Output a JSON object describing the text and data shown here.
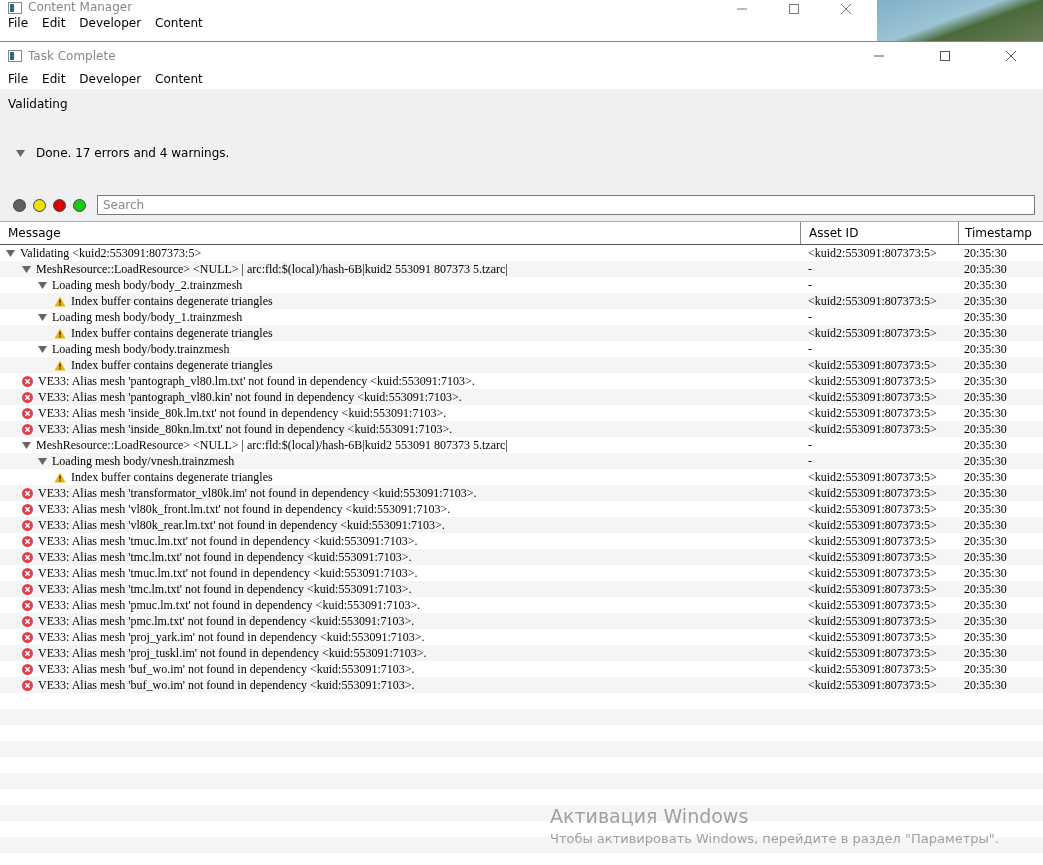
{
  "background_window": {
    "title": "Content Manager",
    "menu": [
      "File",
      "Edit",
      "Developer",
      "Content"
    ]
  },
  "window": {
    "title": "Task Complete",
    "menu": [
      "File",
      "Edit",
      "Developer",
      "Content"
    ]
  },
  "status": "Validating",
  "summary": {
    "text": "Done. 17 errors and 4 warnings.",
    "expanded": true
  },
  "filters": [
    {
      "color": "#606060"
    },
    {
      "color": "#f0e000"
    },
    {
      "color": "#e00000"
    },
    {
      "color": "#10d010"
    }
  ],
  "search": {
    "placeholder": "Search"
  },
  "table": {
    "columns": [
      "Message",
      "Asset ID",
      "Timestamp"
    ],
    "rows": [
      {
        "kind": "group",
        "expanded": true,
        "message": "Validating <kuid2:553091:807373:5>",
        "asset": "<kuid2:553091:807373:5>",
        "time": "20:35:30",
        "children": [
          {
            "kind": "group",
            "expanded": true,
            "message": "MeshResource::LoadResource> <NULL> | arc:fld:$(local)/hash-6B|kuid2 553091 807373 5.tzarc|",
            "asset": "-",
            "time": "20:35:30",
            "children": [
              {
                "kind": "group",
                "expanded": true,
                "message": "Loading mesh body/body_2.trainzmesh",
                "asset": "-",
                "time": "20:35:30",
                "children": [
                  {
                    "kind": "warning",
                    "message": "Index buffer contains degenerate triangles",
                    "asset": "<kuid2:553091:807373:5>",
                    "time": "20:35:30"
                  }
                ]
              },
              {
                "kind": "group",
                "expanded": true,
                "message": "Loading mesh body/body_1.trainzmesh",
                "asset": "-",
                "time": "20:35:30",
                "children": [
                  {
                    "kind": "warning",
                    "message": "Index buffer contains degenerate triangles",
                    "asset": "<kuid2:553091:807373:5>",
                    "time": "20:35:30"
                  }
                ]
              },
              {
                "kind": "group",
                "expanded": true,
                "message": "Loading mesh body/body.trainzmesh",
                "asset": "-",
                "time": "20:35:30",
                "children": [
                  {
                    "kind": "warning",
                    "message": "Index buffer contains degenerate triangles",
                    "asset": "<kuid2:553091:807373:5>",
                    "time": "20:35:30"
                  }
                ]
              }
            ]
          },
          {
            "kind": "error",
            "message": "VE33: Alias mesh 'pantograph_vl80.lm.txt' not found in dependency <kuid:553091:7103>.",
            "asset": "<kuid2:553091:807373:5>",
            "time": "20:35:30"
          },
          {
            "kind": "error",
            "message": "VE33: Alias mesh 'pantograph_vl80.kin' not found in dependency <kuid:553091:7103>.",
            "asset": "<kuid2:553091:807373:5>",
            "time": "20:35:30"
          },
          {
            "kind": "error",
            "message": "VE33: Alias mesh 'inside_80k.lm.txt' not found in dependency <kuid:553091:7103>.",
            "asset": "<kuid2:553091:807373:5>",
            "time": "20:35:30"
          },
          {
            "kind": "error",
            "message": "VE33: Alias mesh 'inside_80kn.lm.txt' not found in dependency <kuid:553091:7103>.",
            "asset": "<kuid2:553091:807373:5>",
            "time": "20:35:30"
          },
          {
            "kind": "group",
            "expanded": true,
            "message": "MeshResource::LoadResource> <NULL> | arc:fld:$(local)/hash-6B|kuid2 553091 807373 5.tzarc|",
            "asset": "-",
            "time": "20:35:30",
            "children": [
              {
                "kind": "group",
                "expanded": true,
                "message": "Loading mesh body/vnesh.trainzmesh",
                "asset": "-",
                "time": "20:35:30",
                "children": [
                  {
                    "kind": "warning",
                    "message": "Index buffer contains degenerate triangles",
                    "asset": "<kuid2:553091:807373:5>",
                    "time": "20:35:30"
                  }
                ]
              }
            ]
          },
          {
            "kind": "error",
            "message": "VE33: Alias mesh 'transformator_vl80k.im' not found in dependency <kuid:553091:7103>.",
            "asset": "<kuid2:553091:807373:5>",
            "time": "20:35:30"
          },
          {
            "kind": "error",
            "message": "VE33: Alias mesh 'vl80k_front.lm.txt' not found in dependency <kuid:553091:7103>.",
            "asset": "<kuid2:553091:807373:5>",
            "time": "20:35:30"
          },
          {
            "kind": "error",
            "message": "VE33: Alias mesh 'vl80k_rear.lm.txt' not found in dependency <kuid:553091:7103>.",
            "asset": "<kuid2:553091:807373:5>",
            "time": "20:35:30"
          },
          {
            "kind": "error",
            "message": "VE33: Alias mesh 'tmuc.lm.txt' not found in dependency <kuid:553091:7103>.",
            "asset": "<kuid2:553091:807373:5>",
            "time": "20:35:30"
          },
          {
            "kind": "error",
            "message": "VE33: Alias mesh 'tmc.lm.txt' not found in dependency <kuid:553091:7103>.",
            "asset": "<kuid2:553091:807373:5>",
            "time": "20:35:30"
          },
          {
            "kind": "error",
            "message": "VE33: Alias mesh 'tmuc.lm.txt' not found in dependency <kuid:553091:7103>.",
            "asset": "<kuid2:553091:807373:5>",
            "time": "20:35:30"
          },
          {
            "kind": "error",
            "message": "VE33: Alias mesh 'tmc.lm.txt' not found in dependency <kuid:553091:7103>.",
            "asset": "<kuid2:553091:807373:5>",
            "time": "20:35:30"
          },
          {
            "kind": "error",
            "message": "VE33: Alias mesh 'pmuc.lm.txt' not found in dependency <kuid:553091:7103>.",
            "asset": "<kuid2:553091:807373:5>",
            "time": "20:35:30"
          },
          {
            "kind": "error",
            "message": "VE33: Alias mesh 'pmc.lm.txt' not found in dependency <kuid:553091:7103>.",
            "asset": "<kuid2:553091:807373:5>",
            "time": "20:35:30"
          },
          {
            "kind": "error",
            "message": "VE33: Alias mesh 'proj_yark.im' not found in dependency <kuid:553091:7103>.",
            "asset": "<kuid2:553091:807373:5>",
            "time": "20:35:30"
          },
          {
            "kind": "error",
            "message": "VE33: Alias mesh 'proj_tuskl.im' not found in dependency <kuid:553091:7103>.",
            "asset": "<kuid2:553091:807373:5>",
            "time": "20:35:30"
          },
          {
            "kind": "error",
            "message": "VE33: Alias mesh 'buf_wo.im' not found in dependency <kuid:553091:7103>.",
            "asset": "<kuid2:553091:807373:5>",
            "time": "20:35:30"
          },
          {
            "kind": "error",
            "message": "VE33: Alias mesh 'buf_wo.im' not found in dependency <kuid:553091:7103>.",
            "asset": "<kuid2:553091:807373:5>",
            "time": "20:35:30"
          }
        ]
      }
    ]
  },
  "activation_notice": {
    "title": "Активация Windows",
    "text": "Чтобы активировать Windows, перейдите в раздел \"Параметры\"."
  }
}
